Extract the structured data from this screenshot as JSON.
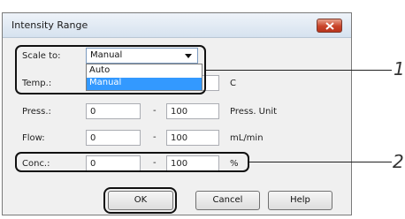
{
  "dialog": {
    "title": "Intensity Range",
    "close_icon": "close-icon",
    "close_color": "#c9442a"
  },
  "rows": {
    "scale": {
      "label": "Scale to:",
      "selected": "Manual",
      "options": [
        "Auto",
        "Manual"
      ]
    },
    "temp": {
      "label": "Temp.:",
      "unit": "C"
    },
    "press": {
      "label": "Press.:",
      "min": "0",
      "sep": "-",
      "max": "100",
      "unit": "Press. Unit"
    },
    "flow": {
      "label": "Flow:",
      "min": "0",
      "sep": "-",
      "max": "100",
      "unit": "mL/min"
    },
    "conc": {
      "label": "Conc.:",
      "min": "0",
      "sep": "-",
      "max": "100",
      "unit": "%"
    }
  },
  "buttons": {
    "ok": "OK",
    "cancel": "Cancel",
    "help": "Help"
  },
  "callouts": {
    "one": "1",
    "two": "2"
  },
  "colors": {
    "selection": "#3399ff",
    "highlight_border": "#111111"
  }
}
